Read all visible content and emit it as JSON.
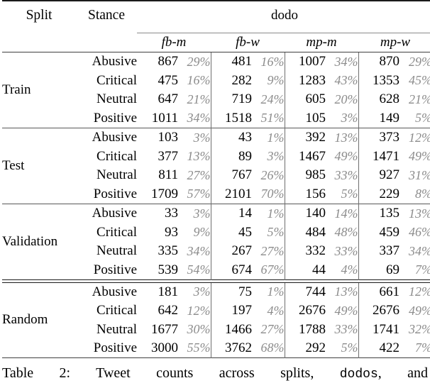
{
  "table": {
    "header": {
      "split_label": "Split",
      "stance_label": "Stance",
      "group_label": "dodo",
      "columns": [
        "fb-m",
        "fb-w",
        "mp-m",
        "mp-w"
      ]
    },
    "splits": [
      {
        "name": "Train",
        "rows": [
          {
            "stance": "Abusive",
            "cells": [
              {
                "count": "867",
                "pct": "29%"
              },
              {
                "count": "481",
                "pct": "16%"
              },
              {
                "count": "1007",
                "pct": "34%"
              },
              {
                "count": "870",
                "pct": "29%"
              }
            ]
          },
          {
            "stance": "Critical",
            "cells": [
              {
                "count": "475",
                "pct": "16%"
              },
              {
                "count": "282",
                "pct": "9%"
              },
              {
                "count": "1283",
                "pct": "43%"
              },
              {
                "count": "1353",
                "pct": "45%"
              }
            ]
          },
          {
            "stance": "Neutral",
            "cells": [
              {
                "count": "647",
                "pct": "21%"
              },
              {
                "count": "719",
                "pct": "24%"
              },
              {
                "count": "605",
                "pct": "20%"
              },
              {
                "count": "628",
                "pct": "21%"
              }
            ]
          },
          {
            "stance": "Positive",
            "cells": [
              {
                "count": "1011",
                "pct": "34%"
              },
              {
                "count": "1518",
                "pct": "51%"
              },
              {
                "count": "105",
                "pct": "3%"
              },
              {
                "count": "149",
                "pct": "5%"
              }
            ]
          }
        ]
      },
      {
        "name": "Test",
        "rows": [
          {
            "stance": "Abusive",
            "cells": [
              {
                "count": "103",
                "pct": "3%"
              },
              {
                "count": "43",
                "pct": "1%"
              },
              {
                "count": "392",
                "pct": "13%"
              },
              {
                "count": "373",
                "pct": "12%"
              }
            ]
          },
          {
            "stance": "Critical",
            "cells": [
              {
                "count": "377",
                "pct": "13%"
              },
              {
                "count": "89",
                "pct": "3%"
              },
              {
                "count": "1467",
                "pct": "49%"
              },
              {
                "count": "1471",
                "pct": "49%"
              }
            ]
          },
          {
            "stance": "Neutral",
            "cells": [
              {
                "count": "811",
                "pct": "27%"
              },
              {
                "count": "767",
                "pct": "26%"
              },
              {
                "count": "985",
                "pct": "33%"
              },
              {
                "count": "927",
                "pct": "31%"
              }
            ]
          },
          {
            "stance": "Positive",
            "cells": [
              {
                "count": "1709",
                "pct": "57%"
              },
              {
                "count": "2101",
                "pct": "70%"
              },
              {
                "count": "156",
                "pct": "5%"
              },
              {
                "count": "229",
                "pct": "8%"
              }
            ]
          }
        ]
      },
      {
        "name": "Validation",
        "rows": [
          {
            "stance": "Abusive",
            "cells": [
              {
                "count": "33",
                "pct": "3%"
              },
              {
                "count": "14",
                "pct": "1%"
              },
              {
                "count": "140",
                "pct": "14%"
              },
              {
                "count": "135",
                "pct": "13%"
              }
            ]
          },
          {
            "stance": "Critical",
            "cells": [
              {
                "count": "93",
                "pct": "9%"
              },
              {
                "count": "45",
                "pct": "5%"
              },
              {
                "count": "484",
                "pct": "48%"
              },
              {
                "count": "459",
                "pct": "46%"
              }
            ]
          },
          {
            "stance": "Neutral",
            "cells": [
              {
                "count": "335",
                "pct": "34%"
              },
              {
                "count": "267",
                "pct": "27%"
              },
              {
                "count": "332",
                "pct": "33%"
              },
              {
                "count": "337",
                "pct": "34%"
              }
            ]
          },
          {
            "stance": "Positive",
            "cells": [
              {
                "count": "539",
                "pct": "54%"
              },
              {
                "count": "674",
                "pct": "67%"
              },
              {
                "count": "44",
                "pct": "4%"
              },
              {
                "count": "69",
                "pct": "7%"
              }
            ]
          }
        ]
      },
      {
        "name": "Random",
        "rows": [
          {
            "stance": "Abusive",
            "cells": [
              {
                "count": "181",
                "pct": "3%"
              },
              {
                "count": "75",
                "pct": "1%"
              },
              {
                "count": "744",
                "pct": "13%"
              },
              {
                "count": "661",
                "pct": "12%"
              }
            ]
          },
          {
            "stance": "Critical",
            "cells": [
              {
                "count": "642",
                "pct": "12%"
              },
              {
                "count": "197",
                "pct": "4%"
              },
              {
                "count": "2676",
                "pct": "49%"
              },
              {
                "count": "2676",
                "pct": "49%"
              }
            ]
          },
          {
            "stance": "Neutral",
            "cells": [
              {
                "count": "1677",
                "pct": "30%"
              },
              {
                "count": "1466",
                "pct": "27%"
              },
              {
                "count": "1788",
                "pct": "33%"
              },
              {
                "count": "1741",
                "pct": "32%"
              }
            ]
          },
          {
            "stance": "Positive",
            "cells": [
              {
                "count": "3000",
                "pct": "55%"
              },
              {
                "count": "3762",
                "pct": "68%"
              },
              {
                "count": "292",
                "pct": "5%"
              },
              {
                "count": "422",
                "pct": "7%"
              }
            ]
          }
        ]
      }
    ]
  },
  "caption": {
    "label": "Table 2:",
    "text_before": "Tweet counts across splits,",
    "mono_term": "dodos",
    "text_after": ", and"
  }
}
